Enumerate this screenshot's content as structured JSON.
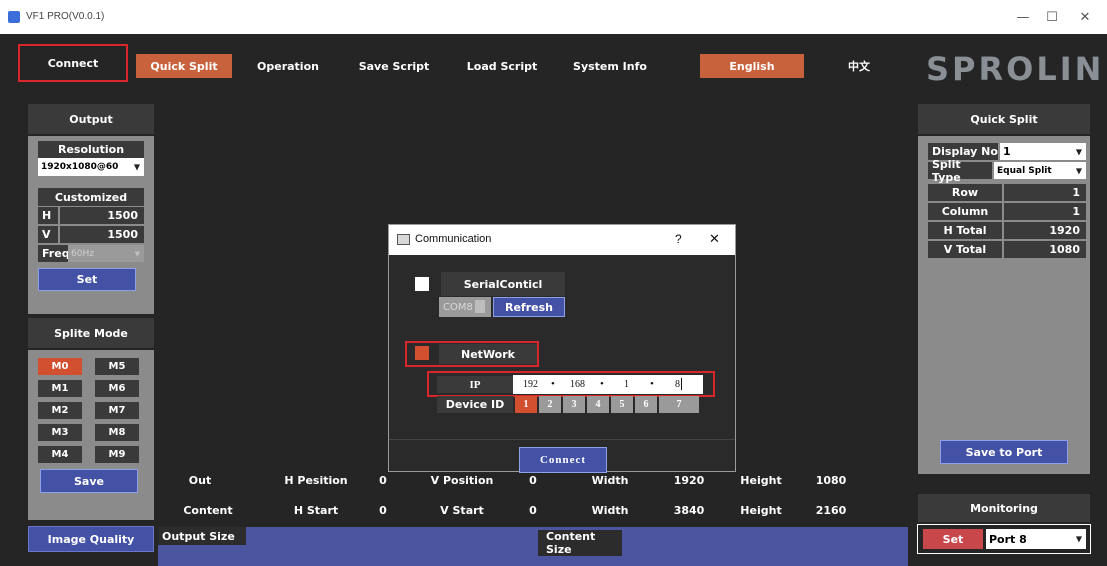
{
  "window": {
    "title": "VF1 PRO(V0.0.1)",
    "controls": {
      "minimize": "—",
      "maximize": "☐",
      "close": "✕"
    }
  },
  "menu": {
    "connect": "Connect",
    "quick_split": "Quick Split",
    "operation": "Operation",
    "save_script": "Save Script",
    "load_script": "Load Script",
    "system_info": "System Info",
    "english": "English",
    "chinese": "中文"
  },
  "brand": {
    "logo": "SPROLINK",
    "reg": "®"
  },
  "output_panel": {
    "header": "Output",
    "resolution_label": "Resolution",
    "resolution_value": "1920x1080@60",
    "customized_label": "Customized",
    "h_label": "H",
    "h_value": "1500",
    "v_label": "V",
    "v_value": "1500",
    "freq_label": "Freq",
    "freq_value": "60Hz",
    "set_button": "Set"
  },
  "splite_mode": {
    "header": "Splite Mode",
    "modes": [
      "M0",
      "M1",
      "M2",
      "M3",
      "M4",
      "M5",
      "M6",
      "M7",
      "M8",
      "M9"
    ],
    "active": "M0",
    "save_button": "Save"
  },
  "image_quality": "Image Quality",
  "bottom_table": {
    "out_row": {
      "label": "Out",
      "h_position_label": "H Pesition",
      "h_position_value": "0",
      "v_position_label": "V Position",
      "v_position_value": "0",
      "width_label": "Width",
      "width_value": "1920",
      "height_label": "Height",
      "height_value": "1080"
    },
    "content_row": {
      "label": "Content",
      "h_start_label": "H Start",
      "h_start_value": "0",
      "v_start_label": "V Start",
      "v_start_value": "0",
      "width_label": "Width",
      "width_value": "3840",
      "height_label": "Height",
      "height_value": "2160"
    },
    "output_size": "Output Size",
    "content_size": "Content Size"
  },
  "quick_split_panel": {
    "header": "Quick Split",
    "display_no_label": "Display No",
    "display_no_value": "1",
    "split_type_label": "Split Type",
    "split_type_value": "Equal Split",
    "row_label": "Row",
    "row_value": "1",
    "column_label": "Column",
    "column_value": "1",
    "h_total_label": "H Total",
    "h_total_value": "1920",
    "v_total_label": "V Total",
    "v_total_value": "1080",
    "save_to_port": "Save to Port"
  },
  "monitoring": {
    "header": "Monitoring",
    "set_button": "Set",
    "port_value": "Port 8"
  },
  "dialog": {
    "title": "Communication",
    "help": "?",
    "close": "✕",
    "serial_label": "SerialConticl",
    "com_value": "COM8",
    "refresh_button": "Refresh",
    "network_label": "NetWork",
    "ip_label": "IP",
    "ip_octets": [
      "192",
      "168",
      "1",
      "8"
    ],
    "ip_separator": "•",
    "device_id_label": "Device ID",
    "device_ids": [
      "1",
      "2",
      "3",
      "4",
      "5",
      "6",
      "7"
    ],
    "device_id_active": "1",
    "connect_button": "Connect"
  },
  "colors": {
    "background": "#252525",
    "accent_orange": "#c8623c",
    "highlight_red": "#d8262b",
    "button_blue": "#4452a6",
    "panel_gray": "#8b8b8b"
  }
}
